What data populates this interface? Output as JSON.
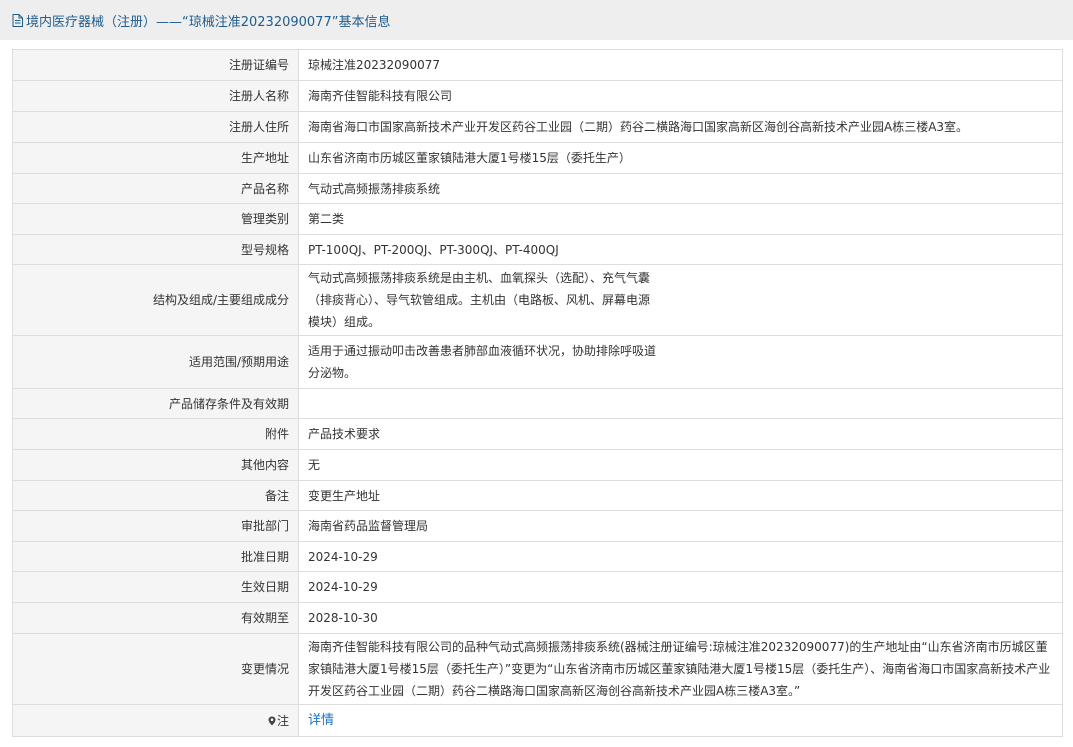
{
  "header": {
    "title": "境内医疗器械（注册）——“琼械注准20232090077”基本信息",
    "doc_icon": "document-icon"
  },
  "rows": [
    {
      "label": "注册证编号",
      "value": "琼械注准20232090077"
    },
    {
      "label": "注册人名称",
      "value": "海南齐佳智能科技有限公司"
    },
    {
      "label": "注册人住所",
      "value": "海南省海口市国家高新技术产业开发区药谷工业园（二期）药谷二横路海口国家高新区海创谷高新技术产业园A栋三楼A3室。"
    },
    {
      "label": "生产地址",
      "value": "山东省济南市历城区董家镇陆港大厦1号楼15层（委托生产）"
    },
    {
      "label": "产品名称",
      "value": "气动式高频振荡排痰系统"
    },
    {
      "label": "管理类别",
      "value": "第二类"
    },
    {
      "label": "型号规格",
      "value": "PT-100QJ、PT-200QJ、PT-300QJ、PT-400QJ"
    },
    {
      "label": "结构及组成/主要组成成分",
      "value": "气动式高频振荡排痰系统是由主机、血氧探头（选配）、充气气囊（排痰背心）、导气软管组成。主机由（电路板、风机、屏幕电源模块）组成。"
    },
    {
      "label": "适用范围/预期用途",
      "value": "适用于通过振动叩击改善患者肺部血液循环状况，协助排除呼吸道分泌物。"
    },
    {
      "label": "产品储存条件及有效期",
      "value": ""
    },
    {
      "label": "附件",
      "value": "产品技术要求"
    },
    {
      "label": "其他内容",
      "value": "无"
    },
    {
      "label": "备注",
      "value": "变更生产地址"
    },
    {
      "label": "审批部门",
      "value": "海南省药品监督管理局"
    },
    {
      "label": "批准日期",
      "value": "2024-10-29"
    },
    {
      "label": "生效日期",
      "value": "2024-10-29"
    },
    {
      "label": "有效期至",
      "value": "2028-10-30"
    },
    {
      "label": "变更情况",
      "value": "海南齐佳智能科技有限公司的品种气动式高频振荡排痰系统(器械注册证编号:琼械注准20232090077)的生产地址由“山东省济南市历城区董家镇陆港大厦1号楼15层（委托生产）”变更为“山东省济南市历城区董家镇陆港大厦1号楼15层（委托生产）、海南省海口市国家高新技术产业开发区药谷工业园（二期）药谷二横路海口国家高新区海创谷高新技术产业园A栋三楼A3室。”"
    }
  ],
  "note": {
    "label": "注",
    "icon": "location-pin-icon",
    "link_text": "详情"
  },
  "colors": {
    "title": "#1f5c8f",
    "link": "#1a73c8",
    "label_bg": "#f5f5f5",
    "border": "#dddddd"
  }
}
